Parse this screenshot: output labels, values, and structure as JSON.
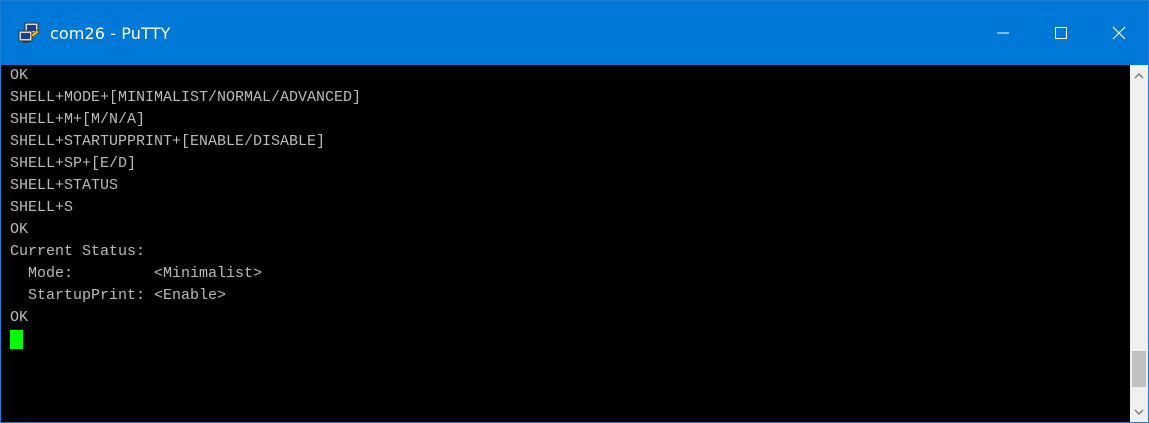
{
  "window": {
    "title": "com26 - PuTTY",
    "app_icon": "putty-icon",
    "controls": [
      "minimize-icon",
      "maximize-icon",
      "close-icon"
    ]
  },
  "terminal": {
    "lines": [
      "OK",
      "SHELL+MODE+[MINIMALIST/NORMAL/ADVANCED]",
      "SHELL+M+[M/N/A]",
      "SHELL+STARTUPPRINT+[ENABLE/DISABLE]",
      "SHELL+SP+[E/D]",
      "SHELL+STATUS",
      "SHELL+S",
      "OK",
      "Current Status:",
      "  Mode:         <Minimalist>",
      "  StartupPrint: <Enable>",
      "OK"
    ],
    "cursor_color": "#00ff00",
    "text_color": "#bbbbbb",
    "background_color": "#000000"
  },
  "scrollbar": {
    "position": 0.95
  },
  "colors": {
    "titlebar": "#0078d7"
  }
}
